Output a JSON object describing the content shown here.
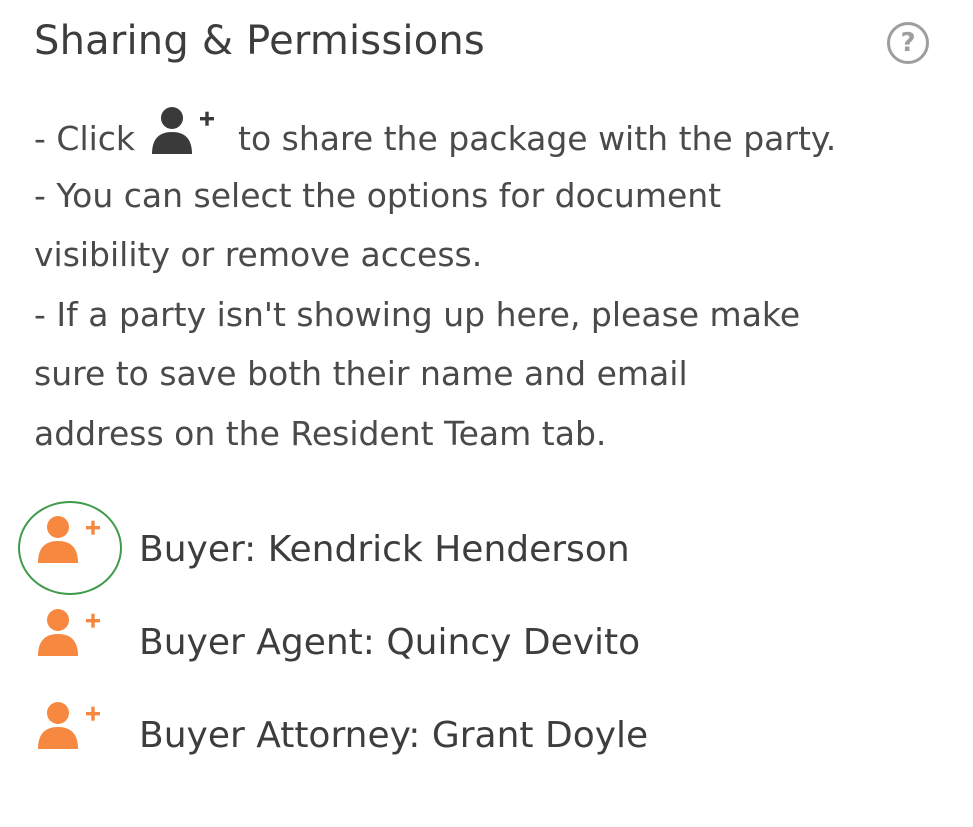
{
  "header": {
    "title": "Sharing & Permissions",
    "help_icon": "question-circle-icon",
    "help_glyph": "?"
  },
  "instructions": {
    "line1_before": "- Click",
    "line1_icon": "user-plus-icon",
    "line1_after": "to share the package with the party.",
    "line2": "- You can select the options for document",
    "line3": "visibility or remove access.",
    "line4": "- If a party isn't showing up here, please make",
    "line5": "sure to save both their name and email",
    "line6": "address on the Resident Team tab."
  },
  "parties": [
    {
      "label": "Buyer: Kendrick Henderson",
      "icon": "user-plus-icon",
      "highlighted": true
    },
    {
      "label": "Buyer Agent: Quincy Devito",
      "icon": "user-plus-icon",
      "highlighted": false
    },
    {
      "label": "Buyer Attorney: Grant Doyle",
      "icon": "user-plus-icon",
      "highlighted": false
    }
  ],
  "colors": {
    "accent_orange": "#F6883F",
    "highlight_green": "#3F9A4A",
    "text_dark": "#3D3D3D",
    "icon_dark": "#3A3A3A"
  }
}
